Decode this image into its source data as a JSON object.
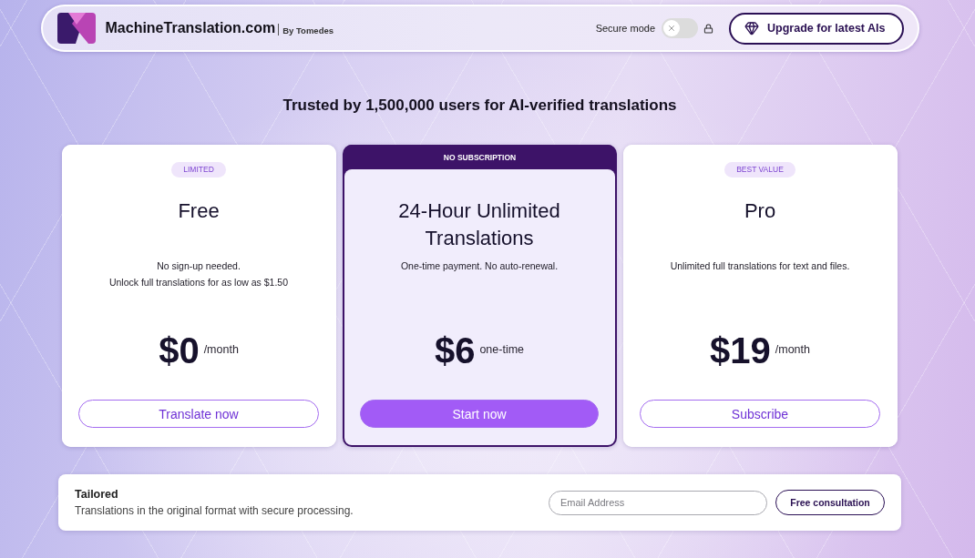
{
  "header": {
    "brand": "MachineTranslation.com",
    "byline": "By Tomedes",
    "secure_mode": {
      "label": "Secure mode",
      "on": false
    },
    "upgrade_button": "Upgrade for latest AIs"
  },
  "headline": "Trusted by 1,500,000 users for AI-verified translations",
  "plans": [
    {
      "kind": "standard",
      "tag": "LIMITED",
      "name": "Free",
      "description": [
        "No sign-up needed.",
        "Unlock full translations for as low as $1.50"
      ],
      "price": "$0",
      "period": "/month",
      "button": "Translate now"
    },
    {
      "kind": "featured",
      "tag": "NO SUBSCRIPTION",
      "name": "24-Hour Unlimited Translations",
      "description": [
        "One-time payment. No auto-renewal."
      ],
      "price": "$6",
      "period": "one-time",
      "button": "Start now"
    },
    {
      "kind": "standard",
      "tag": "BEST VALUE",
      "name": "Pro",
      "description": [
        "Unlimited full translations for text and files."
      ],
      "price": "$19",
      "period": "/month",
      "button": "Subscribe"
    }
  ],
  "consultation": {
    "title": "Tailored",
    "description": "Translations in the original format with secure processing.",
    "email_field": {
      "placeholder": "Email Address"
    },
    "button": "Free consultation"
  }
}
